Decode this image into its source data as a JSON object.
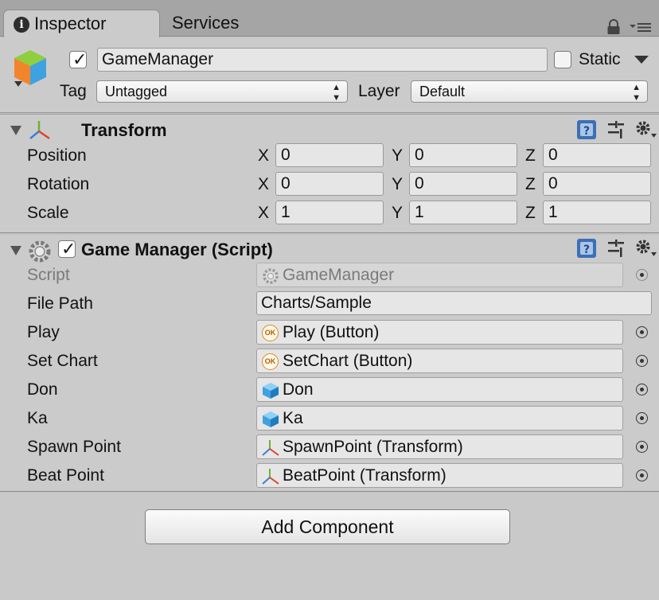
{
  "tabs": [
    {
      "label": "Inspector",
      "active": true
    },
    {
      "label": "Services",
      "active": false
    }
  ],
  "gameobject": {
    "active": true,
    "name": "GameManager",
    "static_label": "Static",
    "static_checked": false,
    "tag_label": "Tag",
    "tag_value": "Untagged",
    "layer_label": "Layer",
    "layer_value": "Default"
  },
  "transform": {
    "title": "Transform",
    "axes": [
      "X",
      "Y",
      "Z"
    ],
    "rows": [
      {
        "label": "Position",
        "values": [
          "0",
          "0",
          "0"
        ]
      },
      {
        "label": "Rotation",
        "values": [
          "0",
          "0",
          "0"
        ]
      },
      {
        "label": "Scale",
        "values": [
          "1",
          "1",
          "1"
        ]
      }
    ]
  },
  "script_component": {
    "title": "Game Manager (Script)",
    "enabled": true,
    "rows": [
      {
        "label": "Script",
        "value": "GameManager",
        "icon": "script-icon",
        "disabled": true
      },
      {
        "label": "File Path",
        "value": "Charts/Sample",
        "icon": "",
        "disabled": false
      },
      {
        "label": "Play",
        "value": "Play (Button)",
        "icon": "ok-icon",
        "disabled": false
      },
      {
        "label": "Set Chart",
        "value": "SetChart (Button)",
        "icon": "ok-icon",
        "disabled": false
      },
      {
        "label": "Don",
        "value": "Don",
        "icon": "cube-icon",
        "disabled": false
      },
      {
        "label": "Ka",
        "value": "Ka",
        "icon": "cube-icon",
        "disabled": false
      },
      {
        "label": "Spawn Point",
        "value": "SpawnPoint (Transform)",
        "icon": "transform-icon",
        "disabled": false
      },
      {
        "label": "Beat Point",
        "value": "BeatPoint (Transform)",
        "icon": "transform-icon",
        "disabled": false
      }
    ]
  },
  "add_component_label": "Add Component",
  "ok_icon_text": "OK",
  "colors": {
    "panel": "#cbcbcb",
    "tabbar": "#a5a5a5",
    "field": "#e6e6e6",
    "ok_icon_orange": "#e08a1e",
    "cube_blue": "#3fa2e0"
  }
}
